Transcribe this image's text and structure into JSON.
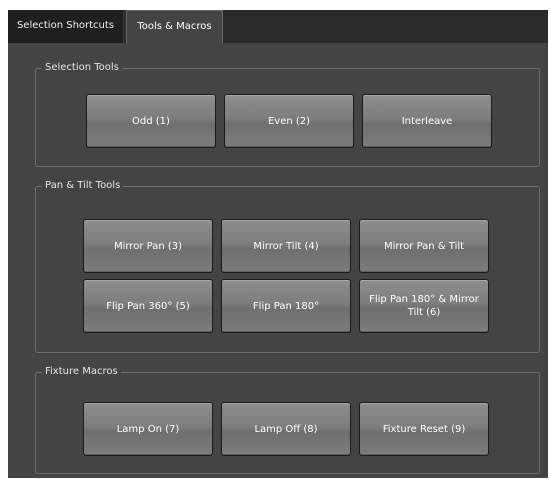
{
  "tabs": [
    {
      "label": "Selection Shortcuts",
      "active": false
    },
    {
      "label": "Tools & Macros",
      "active": true
    }
  ],
  "groups": {
    "selection_tools": {
      "title": "Selection Tools",
      "buttons": [
        "Odd (1)",
        "Even (2)",
        "Interleave"
      ]
    },
    "pan_tilt_tools": {
      "title": "Pan & Tilt Tools",
      "buttons": [
        "Mirror Pan (3)",
        "Mirror Tilt (4)",
        "Mirror Pan & Tilt",
        "Flip Pan 360° (5)",
        "Flip Pan  180°",
        "Flip Pan 180° & Mirror Tilt (6)"
      ]
    },
    "fixture_macros": {
      "title": "Fixture Macros",
      "buttons": [
        "Lamp On (7)",
        "Lamp Off (8)",
        "Fixture Reset (9)"
      ]
    }
  },
  "colors": {
    "panel_bg": "#444444",
    "tabbar_bg": "#2a2a2a",
    "button_text": "#ffffff",
    "group_border": "#6e6e6e"
  }
}
